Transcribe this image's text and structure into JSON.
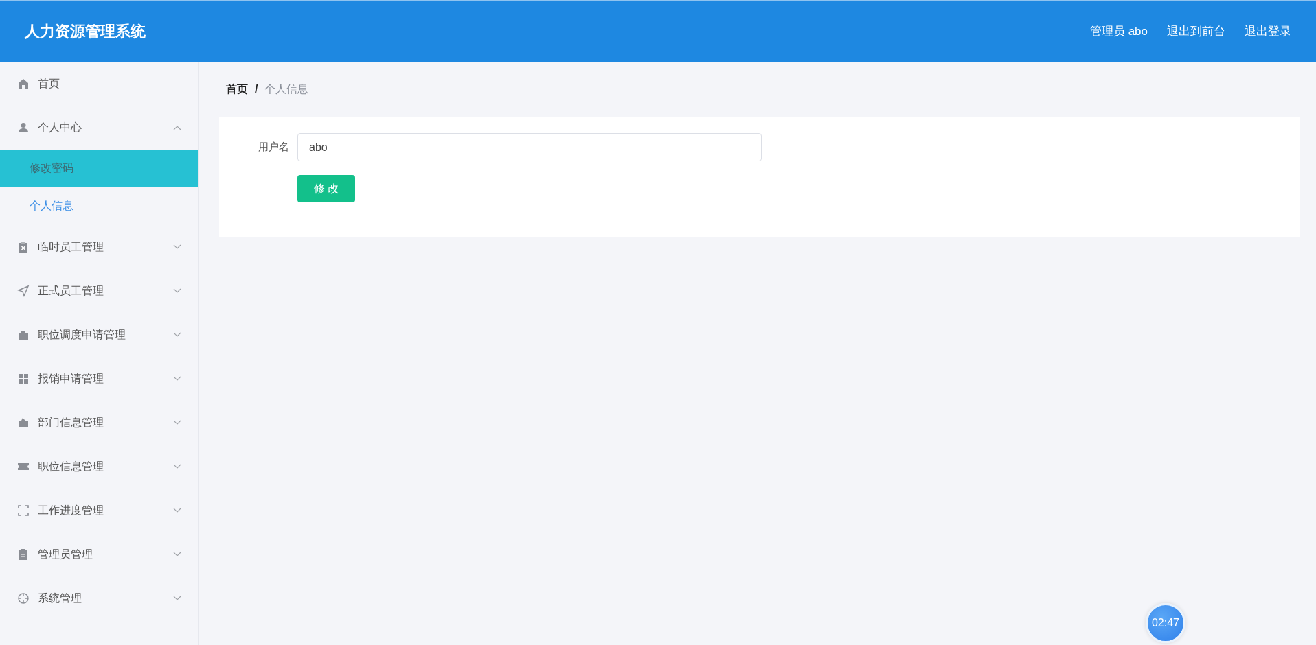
{
  "header": {
    "title": "人力资源管理系统",
    "links": [
      "管理员 abo",
      "退出到前台",
      "退出登录"
    ]
  },
  "sidebar": {
    "items": [
      {
        "label": "首页"
      },
      {
        "label": "个人中心",
        "expanded": true,
        "children": [
          {
            "label": "修改密码",
            "selected": false,
            "hovered": true
          },
          {
            "label": "个人信息",
            "selected": true,
            "hovered": false
          }
        ]
      },
      {
        "label": "临时员工管理",
        "expanded": false
      },
      {
        "label": "正式员工管理",
        "expanded": false
      },
      {
        "label": "职位调度申请管理",
        "expanded": false
      },
      {
        "label": "报销申请管理",
        "expanded": false
      },
      {
        "label": "部门信息管理",
        "expanded": false
      },
      {
        "label": "职位信息管理",
        "expanded": false
      },
      {
        "label": "工作进度管理",
        "expanded": false
      },
      {
        "label": "管理员管理",
        "expanded": false
      },
      {
        "label": "系统管理",
        "expanded": false
      }
    ]
  },
  "breadcrumb": [
    "首页",
    "/",
    "个人信息"
  ],
  "form": {
    "fields": [
      {
        "label": "用户名",
        "value": "abo"
      }
    ],
    "submit": "修 改"
  },
  "timer": "02:47"
}
